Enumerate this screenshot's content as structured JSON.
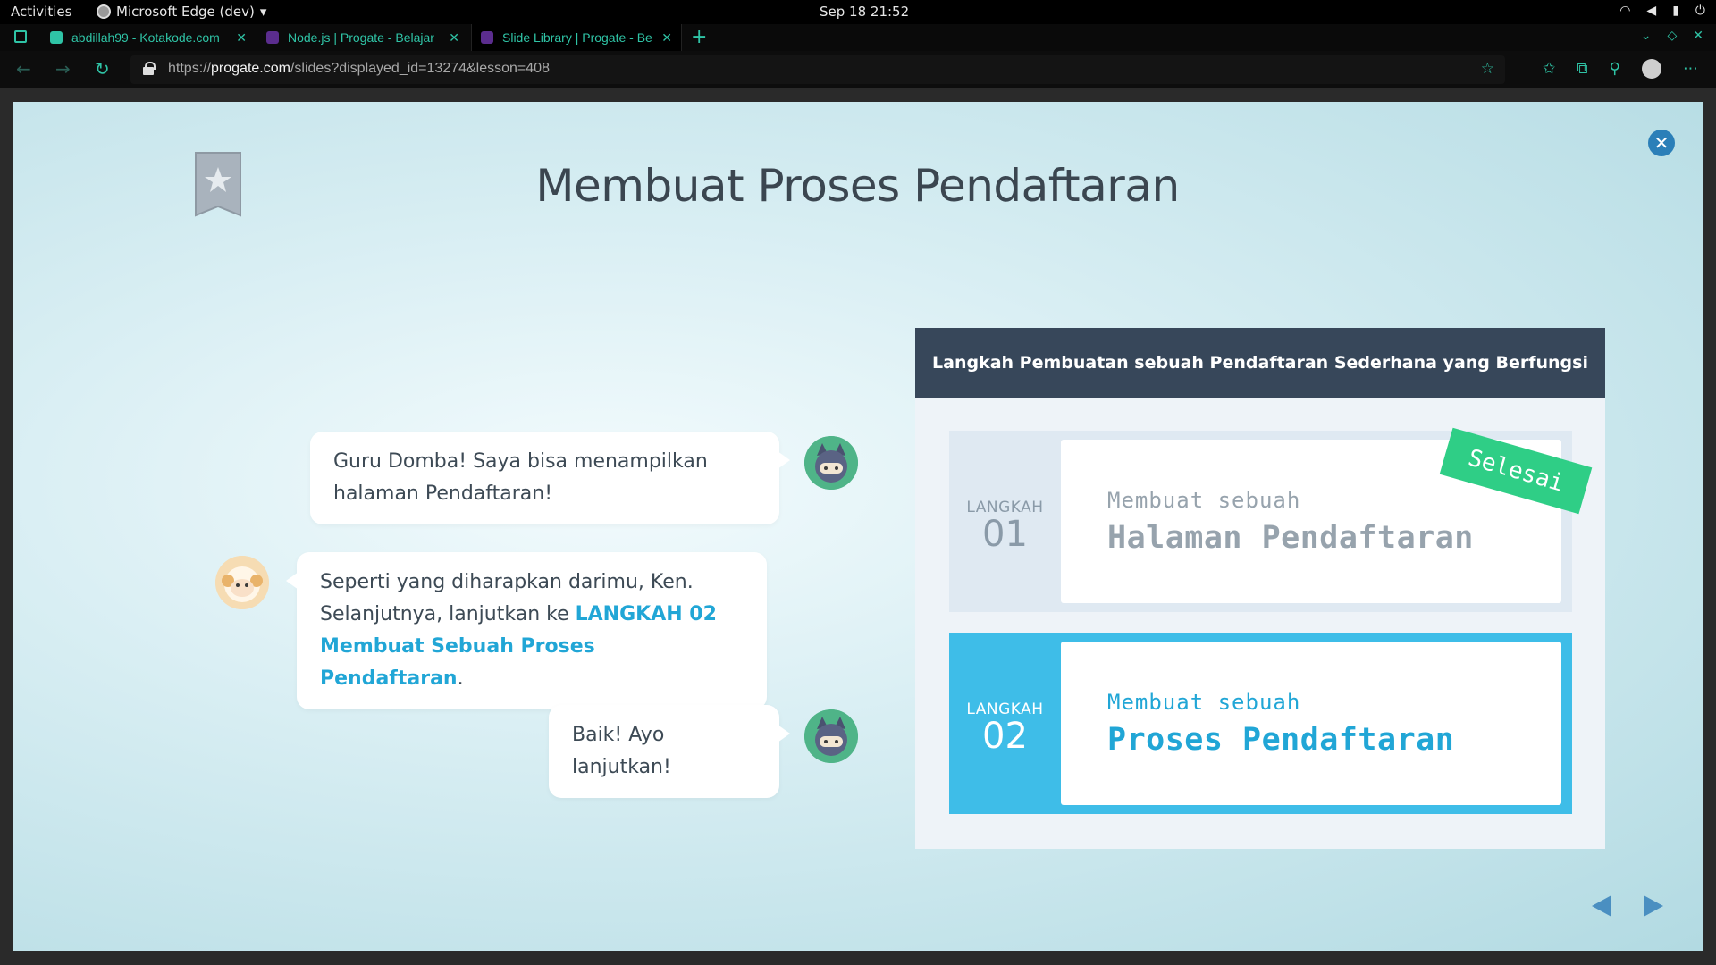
{
  "system_bar": {
    "activities": "Activities",
    "app_name": "Microsoft Edge (dev)",
    "clock": "Sep 18  21:52"
  },
  "tabs": [
    {
      "title": "abdillah99 - Kotakode.com",
      "favicon_color": "#2fc4a6"
    },
    {
      "title": "Node.js | Progate - Belajar",
      "favicon_color": "#5b2d8e"
    },
    {
      "title": "Slide Library | Progate - Belajar",
      "favicon_color": "#5b2d8e"
    }
  ],
  "address": {
    "scheme": "https://",
    "host": "progate.com",
    "path": "/slides?displayed_id=13274&lesson=408"
  },
  "slide": {
    "title": "Membuat Proses Pendaftaran",
    "messages": [
      {
        "speaker": "ken",
        "text": "Guru Domba! Saya bisa menampilkan halaman Pendaftaran!"
      },
      {
        "speaker": "sheep",
        "text_before": "Seperti yang diharapkan darimu, Ken. Selanjutnya, lanjutkan ke ",
        "highlight": "LANGKAH 02 Membuat Sebuah Proses Pendaftaran",
        "text_after": "."
      },
      {
        "speaker": "ken",
        "text": "Baik! Ayo lanjutkan!"
      }
    ],
    "panel": {
      "heading": "Langkah Pembuatan sebuah Pendaftaran Sederhana yang Berfungsi",
      "steps": [
        {
          "label": "LANGKAH",
          "number": "01",
          "subtitle": "Membuat sebuah",
          "title": "Halaman Pendaftaran",
          "status": "Selesai"
        },
        {
          "label": "LANGKAH",
          "number": "02",
          "subtitle": "Membuat sebuah",
          "title": "Proses Pendaftaran"
        }
      ]
    }
  },
  "colors": {
    "accent": "#21a6d6",
    "panel_header": "#37475a",
    "current_step": "#3ebde8",
    "done_badge": "#2fce86"
  }
}
